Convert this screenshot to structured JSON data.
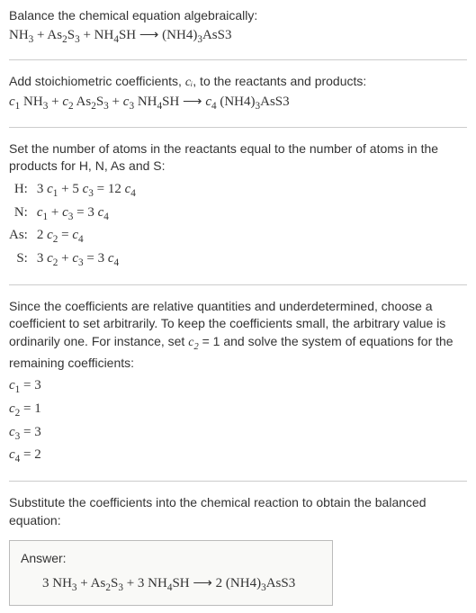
{
  "section1": {
    "title": "Balance the chemical equation algebraically:",
    "equation": "NH₃ + As₂S₃ + NH₄SH ⟶ (NH4)₃AsS3"
  },
  "section2": {
    "title_part1": "Add stoichiometric coefficients, ",
    "title_var": "cᵢ",
    "title_part2": ", to the reactants and products:",
    "equation_c1": "c₁",
    "equation_nh3": " NH₃ + ",
    "equation_c2": "c₂",
    "equation_as2s3": " As₂S₃ + ",
    "equation_c3": "c₃",
    "equation_nh4sh": " NH₄SH ⟶ ",
    "equation_c4": "c₄",
    "equation_prod": " (NH4)₃AsS3"
  },
  "section3": {
    "title": "Set the number of atoms in the reactants equal to the number of atoms in the products for H, N, As and S:",
    "rows": [
      {
        "label": "H:",
        "eq": "3 c₁ + 5 c₃ = 12 c₄"
      },
      {
        "label": "N:",
        "eq": "c₁ + c₃ = 3 c₄"
      },
      {
        "label": "As:",
        "eq": "2 c₂ = c₄"
      },
      {
        "label": "S:",
        "eq": "3 c₂ + c₃ = 3 c₄"
      }
    ]
  },
  "section4": {
    "text_part1": "Since the coefficients are relative quantities and underdetermined, choose a coefficient to set arbitrarily. To keep the coefficients small, the arbitrary value is ordinarily one. For instance, set ",
    "text_var": "c₂",
    "text_part2": " = 1 and solve the system of equations for the remaining coefficients:",
    "coeffs": [
      "c₁ = 3",
      "c₂ = 1",
      "c₃ = 3",
      "c₄ = 2"
    ]
  },
  "section5": {
    "title": "Substitute the coefficients into the chemical reaction to obtain the balanced equation:",
    "answer_label": "Answer:",
    "answer_eq": "3 NH₃ + As₂S₃ + 3 NH₄SH ⟶ 2 (NH4)₃AsS3"
  }
}
